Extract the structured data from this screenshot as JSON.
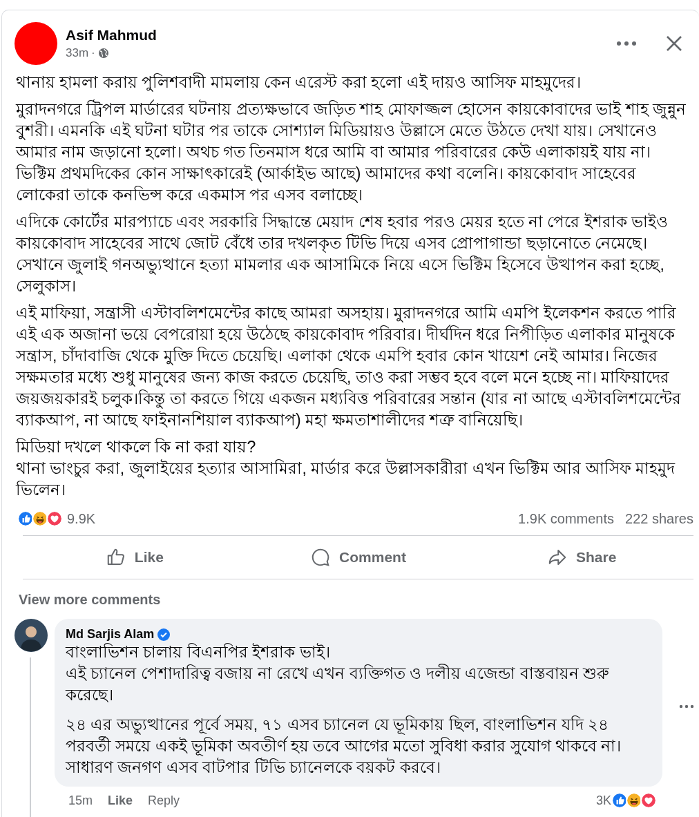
{
  "post": {
    "author": "Asif Mahmud",
    "time": "33m",
    "separator": "·",
    "paragraphs": [
      "থানায় হামলা করায় পুলিশবাদী মামলায় কেন এরেস্ট করা হলো এই দায়ও আসিফ মাহমুদের।",
      "মুরাদনগরে ট্রিপল মার্ডারের ঘটনায় প্রত্যক্ষভাবে জড়িত শাহ মোফাজ্জল হোসেন কায়কোবাদের ভাই শাহ জুন্নুন বুশরী। এমনকি এই ঘটনা ঘটার পর তাকে সোশ্যাল মিডিয়ায়ও উল্লাসে মেতে উঠতে দেখা যায়। সেখানেও আমার নাম জড়ানো হলো। অথচ গত তিনমাস ধরে আমি বা আমার পরিবারের কেউ এলাকায়ই যায় না। ভিক্টিম প্রথমদিকের কোন সাক্ষাৎকারেই (আর্কাইভ আছে) আমাদের কথা বলেনি। কায়কোবাদ সাহেবের লোকেরা তাকে কনভিন্স করে একমাস পর এসব বলাচ্ছে।",
      "এদিকে কোর্টের মারপ্যাচে এবং সরকারি সিদ্ধান্তে মেয়াদ শেষ হবার পরও মেয়র হতে না পেরে ইশরাক ভাইও কায়কোবাদ সাহেবের সাথে জোট বেঁধে তার দখলকৃত টিভি দিয়ে এসব প্রোপাগান্ডা ছড়ানোতে নেমেছে। সেখানে জুলাই গনঅভ্যুত্থানে হত্যা মামলার এক আসামিকে নিয়ে এসে ভিক্টিম হিসেবে উত্থাপন করা হচ্ছে, সেলুকাস।",
      "এই মাফিয়া, সন্ত্রাসী এস্টাবলিশমেন্টের কাছে আমরা অসহায়। মুরাদনগরে আমি এমপি ইলেকশন করতে পারি এই এক অজানা ভয়ে বেপরোয়া হয়ে উঠেছে কায়কোবাদ পরিবার। দীর্ঘদিন ধরে নিপীড়িত এলাকার মানুষকে সন্ত্রাস, চাঁদাবাজি থেকে মুক্তি দিতে চেয়েছি। এলাকা থেকে এমপি হবার কোন খায়েশ নেই আমার। নিজের সক্ষমতার মধ্যে শুধু মানুষের জন্য কাজ করতে চেয়েছি, তাও করা সম্ভব হবে বলে মনে হচ্ছে না। মাফিয়াদের জয়জয়কারই চলুক।কিন্তু তা করতে গিয়ে একজন মধ্যবিত্ত পরিবারের সন্তান (যার না আছে এস্টাবলিশমেন্টের ব্যাকআপ, না আছে ফাইনানশিয়াল ব্যাকআপ) মহা ক্ষমতাশালীদের শত্রু বানিয়েছি।",
      "মিডিয়া দখলে থাকলে কি না করা যায়?\nথানা ভাংচুর করা, জুলাইয়ের হত্যার আসামিরা, মার্ডার করে উল্লাসকারীরা এখন ভিক্টিম আর আসিফ মাহমুদ ভিলেন।"
    ],
    "reactions": [
      {
        "kind": "like"
      },
      {
        "kind": "haha"
      },
      {
        "kind": "love"
      }
    ],
    "reaction_count": "9.9K",
    "comments": "1.9K comments",
    "shares": "222 shares",
    "actions": [
      {
        "kind": "like",
        "label": "Like"
      },
      {
        "kind": "comment",
        "label": "Comment"
      },
      {
        "kind": "share",
        "label": "Share"
      }
    ]
  },
  "view_more": "View more comments",
  "comment": {
    "author": "Md Sarjis Alam",
    "verified": true,
    "paragraphs": [
      "বাংলাভিশন চালায় বিএনপির ইশরাক ভাই।\nএই চ্যানেল পেশাদারিত্ব বজায় না রেখে এখন ব্যক্তিগত ও দলীয় এজেন্ডা বাস্তবায়ন শুরু করেছে।",
      "২৪ এর অভ্যুত্থানের পূর্বে সময়, ৭১ এসব চ্যানেল যে ভূমিকায় ছিল, বাংলাভিশন যদি ২৪ পরবর্তী সময়ে একই ভূমিকা অবতীর্ণ হয় তবে আগের মতো সুবিধা করার সুযোগ থাকবে না।\nসাধারণ জনগণ এসব বাটপার টিভি চ্যানেলকে বয়কট করবে।"
    ],
    "time": "15m",
    "like": "Like",
    "reply": "Reply",
    "reaction_count": "3K",
    "reactions": [
      {
        "kind": "like"
      },
      {
        "kind": "haha"
      },
      {
        "kind": "love"
      }
    ]
  }
}
